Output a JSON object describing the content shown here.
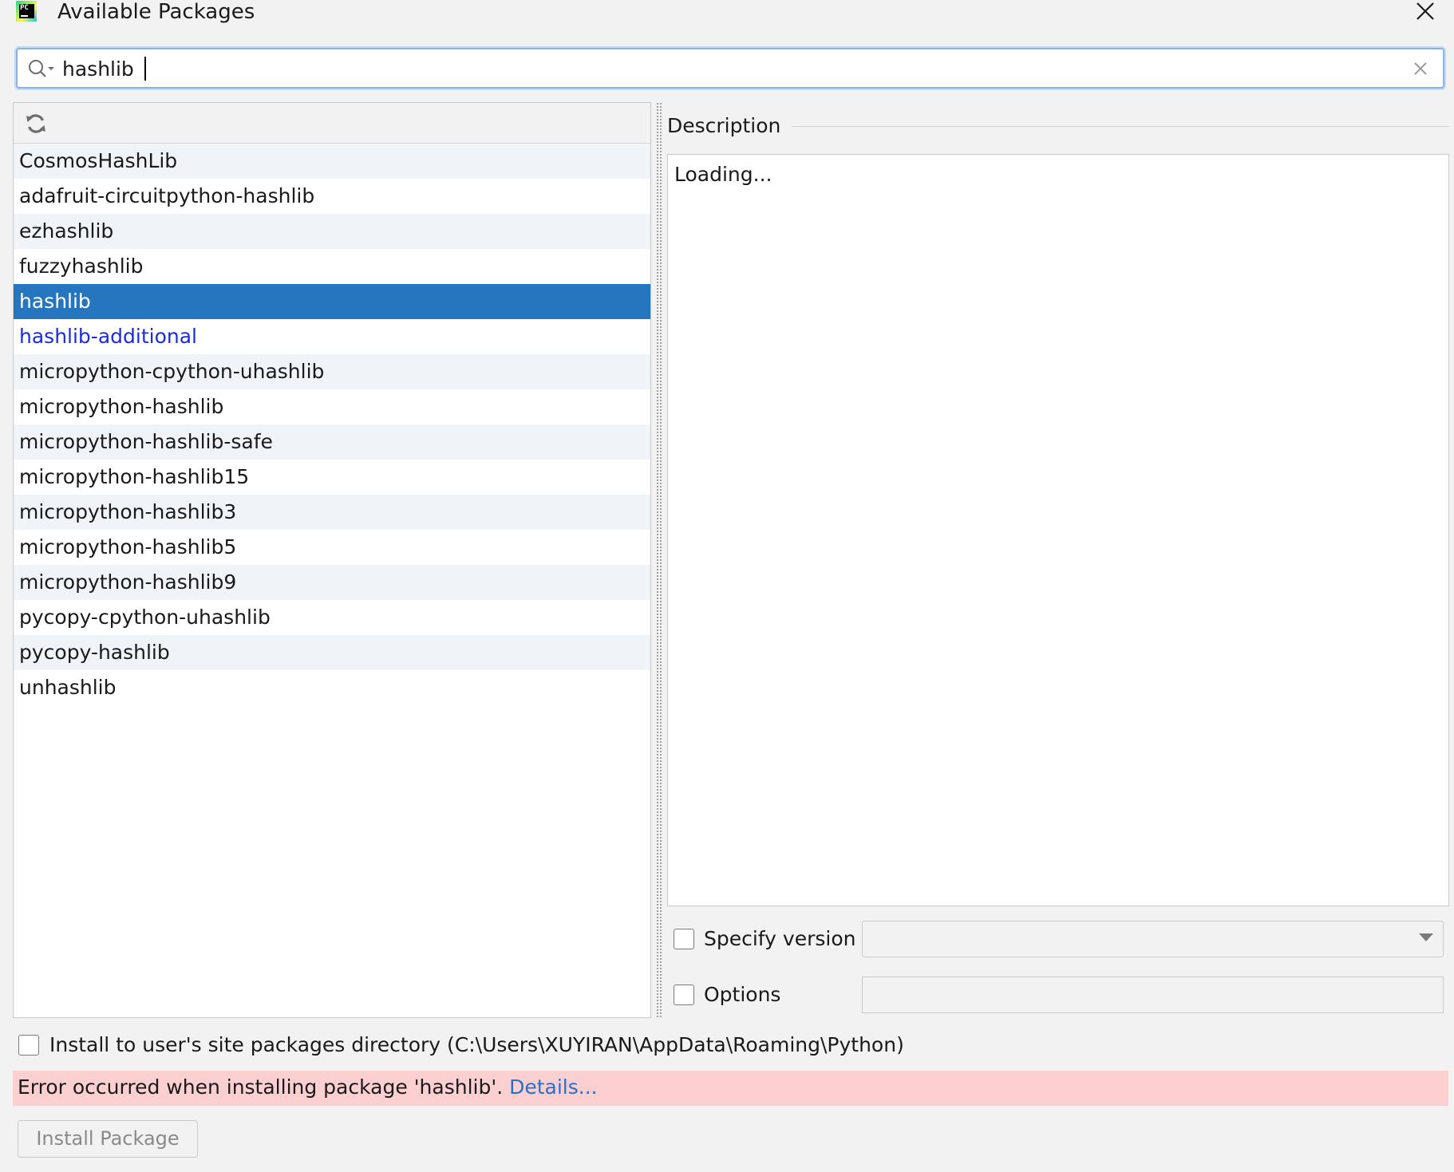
{
  "window": {
    "title": "Available Packages",
    "logo_text": "PC",
    "close_icon": "close-icon"
  },
  "search": {
    "value": "hashlib",
    "icon": "search-icon",
    "clear_icon": "clear-icon"
  },
  "toolbar": {
    "refresh_icon": "refresh-icon"
  },
  "packages": [
    {
      "name": "CosmosHashLib",
      "state": "normal"
    },
    {
      "name": "adafruit-circuitpython-hashlib",
      "state": "normal"
    },
    {
      "name": "ezhashlib",
      "state": "normal"
    },
    {
      "name": "fuzzyhashlib",
      "state": "normal"
    },
    {
      "name": "hashlib",
      "state": "selected"
    },
    {
      "name": "hashlib-additional",
      "state": "link"
    },
    {
      "name": "micropython-cpython-uhashlib",
      "state": "normal"
    },
    {
      "name": "micropython-hashlib",
      "state": "normal"
    },
    {
      "name": "micropython-hashlib-safe",
      "state": "normal"
    },
    {
      "name": "micropython-hashlib15",
      "state": "normal"
    },
    {
      "name": "micropython-hashlib3",
      "state": "normal"
    },
    {
      "name": "micropython-hashlib5",
      "state": "normal"
    },
    {
      "name": "micropython-hashlib9",
      "state": "normal"
    },
    {
      "name": "pycopy-cpython-uhashlib",
      "state": "normal"
    },
    {
      "name": "pycopy-hashlib",
      "state": "normal"
    },
    {
      "name": "unhashlib",
      "state": "normal"
    }
  ],
  "description": {
    "label": "Description",
    "text": "Loading..."
  },
  "specify_version": {
    "label": "Specify version",
    "checked": false,
    "value": ""
  },
  "options": {
    "label": "Options",
    "checked": false,
    "value": ""
  },
  "user_site": {
    "label": "Install to user's site packages directory (C:\\Users\\XUYIRAN\\AppData\\Roaming\\Python)",
    "checked": false
  },
  "error": {
    "message": "Error occurred when installing package 'hashlib'.",
    "details_link": "Details..."
  },
  "install_button": {
    "label": "Install Package",
    "enabled": false
  },
  "colors": {
    "selection": "#2675bf",
    "link": "#1a2be0",
    "error_bg": "#fccfd0",
    "details_link": "#2a6fcc",
    "window_bg": "#f2f2f2"
  }
}
